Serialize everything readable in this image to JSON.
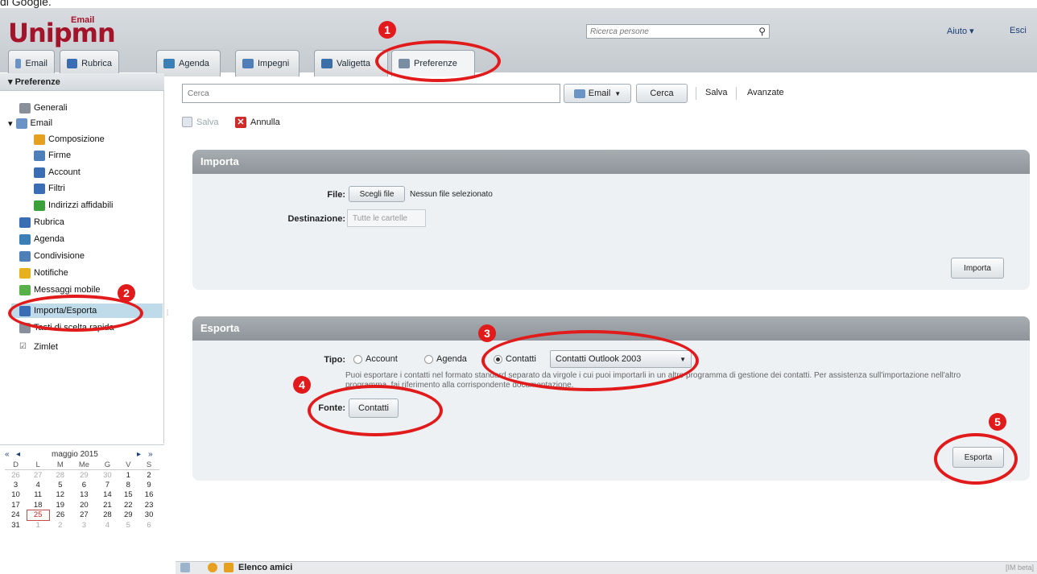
{
  "top_caption": "di Google.",
  "app": {
    "logo": "Unipmn",
    "logo_super": "Email",
    "people_search_placeholder": "Ricerca persone",
    "help": "Aiuto ▾",
    "logout": "Esci",
    "tabs": [
      {
        "label": "Email",
        "icon": "mail-icon",
        "color": "#6b93c6"
      },
      {
        "label": "Rubrica",
        "icon": "contacts-icon",
        "color": "#3a6db4"
      },
      {
        "label": "Agenda",
        "icon": "calendar-icon",
        "color": "#3a7fb5"
      },
      {
        "label": "Impegni",
        "icon": "tasks-icon",
        "color": "#4f7fb9"
      },
      {
        "label": "Valigetta",
        "icon": "briefcase-icon",
        "color": "#3b6fa8"
      },
      {
        "label": "Preferenze",
        "icon": "preferences-icon",
        "color": "#7a8ea3"
      }
    ]
  },
  "sidebar": {
    "header": "Preferenze",
    "items": [
      {
        "label": "Generali",
        "icon": "gear-icon",
        "color": "#8a9099"
      },
      {
        "label": "Email",
        "icon": "mail-icon",
        "color": "#6b93c6"
      },
      {
        "label": "Composizione",
        "icon": "compose-icon",
        "color": "#e6a020"
      },
      {
        "label": "Firme",
        "icon": "signature-icon",
        "color": "#4f7fb9"
      },
      {
        "label": "Account",
        "icon": "account-icon",
        "color": "#3a6db4"
      },
      {
        "label": "Filtri",
        "icon": "filter-icon",
        "color": "#3a6db4"
      },
      {
        "label": "Indirizzi affidabili",
        "icon": "shield-icon",
        "color": "#3aa03a"
      },
      {
        "label": "Rubrica",
        "icon": "contacts-icon",
        "color": "#3a6db4"
      },
      {
        "label": "Agenda",
        "icon": "calendar-icon",
        "color": "#3a7fb5"
      },
      {
        "label": "Condivisione",
        "icon": "sharing-icon",
        "color": "#4f7fb9"
      },
      {
        "label": "Notifiche",
        "icon": "notification-icon",
        "color": "#e6b020"
      },
      {
        "label": "Messaggi mobile",
        "icon": "mobile-icon",
        "color": "#58b048"
      },
      {
        "label": "Importa/Esporta",
        "icon": "import-export-icon",
        "color": "#3a6db4"
      },
      {
        "label": "Tasti di scelta rapida",
        "icon": "keyboard-icon",
        "color": "#8a9099"
      },
      {
        "label": "Zimlet",
        "icon": "zimlet-icon",
        "color": "#555"
      }
    ]
  },
  "calendar": {
    "month_label": "maggio 2015",
    "weekdays": [
      "D",
      "L",
      "M",
      "Me",
      "G",
      "V",
      "S"
    ],
    "weeks": [
      [
        "26",
        "27",
        "28",
        "29",
        "30",
        "1",
        "2"
      ],
      [
        "3",
        "4",
        "5",
        "6",
        "7",
        "8",
        "9"
      ],
      [
        "10",
        "11",
        "12",
        "13",
        "14",
        "15",
        "16"
      ],
      [
        "17",
        "18",
        "19",
        "20",
        "21",
        "22",
        "23"
      ],
      [
        "24",
        "25",
        "26",
        "27",
        "28",
        "29",
        "30"
      ],
      [
        "31",
        "1",
        "2",
        "3",
        "4",
        "5",
        "6"
      ]
    ],
    "today": "25"
  },
  "toolbar": {
    "search_placeholder": "Cerca",
    "scope": "Email",
    "search_button": "Cerca",
    "save_link": "Salva",
    "advanced_link": "Avanzate"
  },
  "actions": {
    "save": "Salva",
    "cancel": "Annulla"
  },
  "import_panel": {
    "title": "Importa",
    "file_label": "File:",
    "choose_file": "Scegli file",
    "no_file": "Nessun file selezionato",
    "destination_label": "Destinazione:",
    "destination_value": "Tutte le cartelle",
    "import_button": "Importa"
  },
  "export_panel": {
    "title": "Esporta",
    "type_label": "Tipo:",
    "types": [
      "Account",
      "Agenda",
      "Contatti"
    ],
    "selected_type": "Contatti",
    "format": "Contatti Outlook 2003",
    "hint": "Puoi esportare i contatti nel formato standard separato da virgole i cui puoi importarli in un altro programma di gestione dei contatti. Per assistenza sull'importazione nell'altro programma, fai riferimento alla corrispondente documentazione.",
    "source_label": "Fonte:",
    "source_value": "Contatti",
    "export_button": "Esporta"
  },
  "statusbar": {
    "friends": "Elenco amici",
    "version": "[IM beta]"
  },
  "annotations": [
    "1",
    "2",
    "3",
    "4",
    "5"
  ]
}
